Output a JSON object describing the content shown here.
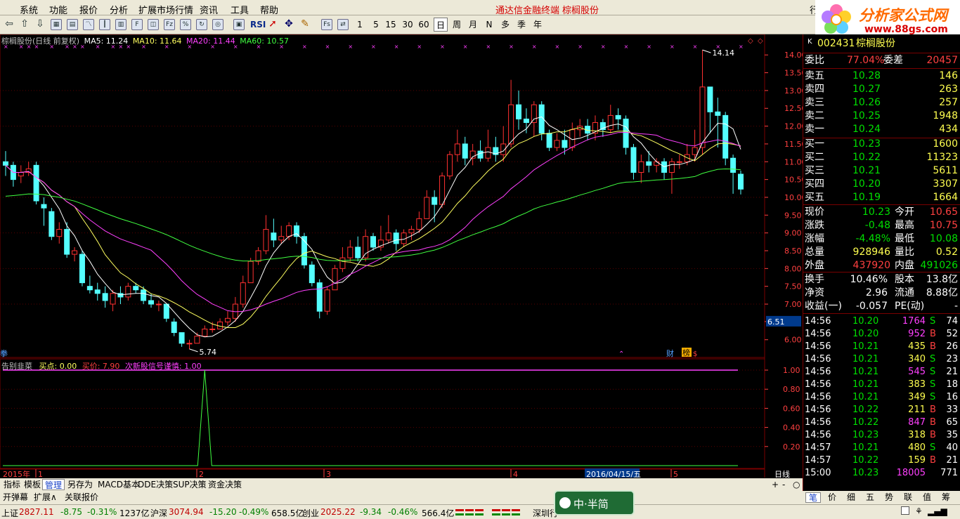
{
  "menu": {
    "items": [
      "系统",
      "功能",
      "报价",
      "分析",
      "扩展市场行情",
      "资讯",
      "工具",
      "帮助"
    ],
    "center_title": "通达信金融终端",
    "stock_title": "棕榈股份",
    "right_btn": "行"
  },
  "logo": {
    "text": "分析家公式网",
    "url": "www.88gs.com"
  },
  "toolbar": {
    "periods": [
      "1",
      "5",
      "15",
      "30",
      "60"
    ],
    "cycles": [
      "日",
      "周",
      "月",
      "N",
      "多",
      "季",
      "年"
    ],
    "selected_cycle": "日",
    "rsi": "RSI"
  },
  "chart_header": {
    "title": "棕榈股份(日线 前复权)",
    "ma5": "MA5: 11.24",
    "ma10": "MA10: 11.64",
    "ma20": "MA20: 11.44",
    "ma60": "MA60: 10.57"
  },
  "indicator_header": {
    "name": "告别韭菜",
    "buy_point": "买点: 0.00",
    "buy_price": "买价: 7.90",
    "signal": "次新股信号谨慎: 1.00"
  },
  "price_axis": [
    "14.00",
    "13.50",
    "13.00",
    "12.50",
    "12.00",
    "11.50",
    "11.00",
    "10.50",
    "10.00",
    "9.50",
    "9.00",
    "8.50",
    "8.00",
    "7.50",
    "7.00",
    "6.51",
    "6.00"
  ],
  "crosshair_price": "6.51",
  "indicator_axis": [
    "1.00",
    "0.80",
    "0.60",
    "0.40",
    "0.20"
  ],
  "annotations": {
    "high": "14.14",
    "low": "5.74",
    "fin": "财",
    "rank": "榜",
    "quan": "$",
    "left_mark": "拳"
  },
  "time_axis": {
    "year": "2015年",
    "months": [
      "1",
      "2",
      "3",
      "4",
      "5"
    ],
    "cursor_date": "2016/04/15/五",
    "period": "日线"
  },
  "chart_data": {
    "type": "candlestick",
    "title": "棕榈股份(日线 前复权)",
    "ylim": [
      5.6,
      14.3
    ],
    "candles": [
      [
        11.0,
        10.9,
        11.3,
        10.6
      ],
      [
        10.9,
        10.5,
        11.0,
        10.3
      ],
      [
        10.6,
        10.7,
        10.9,
        10.4
      ],
      [
        10.7,
        10.8,
        11.0,
        10.6
      ],
      [
        10.9,
        9.9,
        11.0,
        9.8
      ],
      [
        9.8,
        9.7,
        10.0,
        9.2
      ],
      [
        9.6,
        8.9,
        9.7,
        8.8
      ],
      [
        8.9,
        9.1,
        9.3,
        8.7
      ],
      [
        9.1,
        8.4,
        9.3,
        8.3
      ],
      [
        8.4,
        8.5,
        8.6,
        8.2
      ],
      [
        8.4,
        7.6,
        8.5,
        7.5
      ],
      [
        7.5,
        7.4,
        7.8,
        7.3
      ],
      [
        7.4,
        7.3,
        7.6,
        7.1
      ],
      [
        7.3,
        7.1,
        7.5,
        6.9
      ],
      [
        7.0,
        7.3,
        7.4,
        6.8
      ],
      [
        7.3,
        7.2,
        7.5,
        7.0
      ],
      [
        7.2,
        7.5,
        7.6,
        7.1
      ],
      [
        7.5,
        7.4,
        7.6,
        7.3
      ],
      [
        7.4,
        7.1,
        7.5,
        7.0
      ],
      [
        7.1,
        7.0,
        7.3,
        6.9
      ],
      [
        7.0,
        7.0,
        7.1,
        6.8
      ],
      [
        7.0,
        6.6,
        7.0,
        6.5
      ],
      [
        6.5,
        6.2,
        6.6,
        6.1
      ],
      [
        6.2,
        5.9,
        6.2,
        5.8
      ],
      [
        5.9,
        5.9,
        6.0,
        5.74
      ],
      [
        5.9,
        6.1,
        6.2,
        5.9
      ],
      [
        6.1,
        6.3,
        6.4,
        6.1
      ],
      [
        6.3,
        6.3,
        6.5,
        6.2
      ],
      [
        6.3,
        6.5,
        6.6,
        6.3
      ],
      [
        6.5,
        6.6,
        6.8,
        6.4
      ],
      [
        6.6,
        7.0,
        7.2,
        6.5
      ],
      [
        7.0,
        7.6,
        7.8,
        6.9
      ],
      [
        7.6,
        8.2,
        8.3,
        7.6
      ],
      [
        8.2,
        8.5,
        8.6,
        8.1
      ],
      [
        8.5,
        9.1,
        9.5,
        8.4
      ],
      [
        9.0,
        8.8,
        9.4,
        8.6
      ],
      [
        8.8,
        8.9,
        9.2,
        8.7
      ],
      [
        8.9,
        9.2,
        9.3,
        8.8
      ],
      [
        9.2,
        8.9,
        9.3,
        8.7
      ],
      [
        8.9,
        8.1,
        9.0,
        8.0
      ],
      [
        8.1,
        7.6,
        8.2,
        7.5
      ],
      [
        7.6,
        6.8,
        7.7,
        6.6
      ],
      [
        6.8,
        7.4,
        7.5,
        6.7
      ],
      [
        7.4,
        8.0,
        8.1,
        7.4
      ],
      [
        8.0,
        8.3,
        8.6,
        7.9
      ],
      [
        8.3,
        8.6,
        8.8,
        8.2
      ],
      [
        8.6,
        8.3,
        8.9,
        8.2
      ],
      [
        8.3,
        8.9,
        9.1,
        8.2
      ],
      [
        8.9,
        8.6,
        9.0,
        8.5
      ],
      [
        8.6,
        8.8,
        9.2,
        8.5
      ],
      [
        8.8,
        9.0,
        9.5,
        8.7
      ],
      [
        9.0,
        8.7,
        9.1,
        8.5
      ],
      [
        8.7,
        9.0,
        9.1,
        8.6
      ],
      [
        9.0,
        9.1,
        9.2,
        8.8
      ],
      [
        9.1,
        9.4,
        9.6,
        9.0
      ],
      [
        9.4,
        10.0,
        10.2,
        9.4
      ],
      [
        10.0,
        9.8,
        10.2,
        9.3
      ],
      [
        9.8,
        10.6,
        10.7,
        9.7
      ],
      [
        10.6,
        11.2,
        11.3,
        10.5
      ],
      [
        11.2,
        11.5,
        11.9,
        11.0
      ],
      [
        11.5,
        11.1,
        11.7,
        10.9
      ],
      [
        11.1,
        11.3,
        11.5,
        10.9
      ],
      [
        11.3,
        11.1,
        11.6,
        11.0
      ],
      [
        11.1,
        11.4,
        11.9,
        11.0
      ],
      [
        11.4,
        11.2,
        11.7,
        11.0
      ],
      [
        11.2,
        11.5,
        12.0,
        11.0
      ],
      [
        11.5,
        12.6,
        13.3,
        11.4
      ],
      [
        12.6,
        12.2,
        13.0,
        11.9
      ],
      [
        12.2,
        12.1,
        12.5,
        11.8
      ],
      [
        12.1,
        12.6,
        12.7,
        11.7
      ],
      [
        12.6,
        11.8,
        12.7,
        11.6
      ],
      [
        11.8,
        11.4,
        11.9,
        11.3
      ],
      [
        11.4,
        11.6,
        11.8,
        11.3
      ],
      [
        11.6,
        11.4,
        11.9,
        11.2
      ],
      [
        11.4,
        11.9,
        12.1,
        11.3
      ],
      [
        11.9,
        12.0,
        12.2,
        11.7
      ],
      [
        12.0,
        11.8,
        12.2,
        11.6
      ],
      [
        11.8,
        12.1,
        12.3,
        11.6
      ],
      [
        12.1,
        11.9,
        12.2,
        11.7
      ],
      [
        11.9,
        12.3,
        12.6,
        11.8
      ],
      [
        12.3,
        12.2,
        12.5,
        11.9
      ],
      [
        12.2,
        11.4,
        12.3,
        11.2
      ],
      [
        11.4,
        10.7,
        11.5,
        10.5
      ],
      [
        10.7,
        11.0,
        11.2,
        10.4
      ],
      [
        11.0,
        10.9,
        11.3,
        10.7
      ],
      [
        10.9,
        11.0,
        11.1,
        10.7
      ],
      [
        11.0,
        10.7,
        11.1,
        10.5
      ],
      [
        10.7,
        11.0,
        11.1,
        10.1
      ],
      [
        11.0,
        11.0,
        11.2,
        10.8
      ],
      [
        11.0,
        11.2,
        11.5,
        10.9
      ],
      [
        11.2,
        11.4,
        11.9,
        11.0
      ],
      [
        11.4,
        13.1,
        14.14,
        11.2
      ],
      [
        13.1,
        12.4,
        13.0,
        11.8
      ],
      [
        12.4,
        12.3,
        12.8,
        11.4
      ],
      [
        12.3,
        11.1,
        12.4,
        10.9
      ],
      [
        11.1,
        10.7,
        11.2,
        10.1
      ],
      [
        10.65,
        10.23,
        10.75,
        10.08
      ]
    ],
    "indicator_signal_index": 26
  },
  "quote": {
    "code": "002431",
    "name": "棕榈股份",
    "wb_label": "委比",
    "wb": "77.04%",
    "wc_label": "委差",
    "wc": "20457",
    "asks": [
      {
        "label": "卖五",
        "price": "10.28",
        "vol": "146"
      },
      {
        "label": "卖四",
        "price": "10.27",
        "vol": "263"
      },
      {
        "label": "卖三",
        "price": "10.26",
        "vol": "257"
      },
      {
        "label": "卖二",
        "price": "10.25",
        "vol": "1948"
      },
      {
        "label": "卖一",
        "price": "10.24",
        "vol": "434"
      }
    ],
    "bids": [
      {
        "label": "买一",
        "price": "10.23",
        "vol": "1600"
      },
      {
        "label": "买二",
        "price": "10.22",
        "vol": "11323"
      },
      {
        "label": "买三",
        "price": "10.21",
        "vol": "5611"
      },
      {
        "label": "买四",
        "price": "10.20",
        "vol": "3307"
      },
      {
        "label": "买五",
        "price": "10.19",
        "vol": "1664"
      }
    ],
    "stats": [
      {
        "l1": "现价",
        "v1": "10.23",
        "l2": "今开",
        "v2": "10.65",
        "c1": "grn",
        "c2": "red"
      },
      {
        "l1": "涨跌",
        "v1": "-0.48",
        "l2": "最高",
        "v2": "10.75",
        "c1": "grn",
        "c2": "red"
      },
      {
        "l1": "涨幅",
        "v1": "-4.48%",
        "l2": "最低",
        "v2": "10.08",
        "c1": "grn",
        "c2": "grn"
      },
      {
        "l1": "总量",
        "v1": "928946",
        "l2": "量比",
        "v2": "0.52",
        "c1": "yel",
        "c2": "yel"
      },
      {
        "l1": "外盘",
        "v1": "437920",
        "l2": "内盘",
        "v2": "491026",
        "c1": "red",
        "c2": "grn"
      },
      {
        "l1": "换手",
        "v1": "10.46%",
        "l2": "股本",
        "v2": "13.8亿",
        "c1": "wht",
        "c2": "wht"
      },
      {
        "l1": "净资",
        "v1": "2.96",
        "l2": "流通",
        "v2": "8.88亿",
        "c1": "wht",
        "c2": "wht"
      },
      {
        "l1": "收益(一)",
        "v1": "-0.057",
        "l2": "PE(动)",
        "v2": "-",
        "c1": "wht",
        "c2": "wht"
      }
    ],
    "ticks": [
      {
        "t": "14:56",
        "p": "10.20",
        "v": "1764",
        "s": "S",
        "n": "74",
        "vc": "mag"
      },
      {
        "t": "14:56",
        "p": "10.20",
        "v": "952",
        "s": "B",
        "n": "52",
        "vc": "mag"
      },
      {
        "t": "14:56",
        "p": "10.21",
        "v": "435",
        "s": "B",
        "n": "26",
        "vc": "yel"
      },
      {
        "t": "14:56",
        "p": "10.21",
        "v": "340",
        "s": "S",
        "n": "23",
        "vc": "yel"
      },
      {
        "t": "14:56",
        "p": "10.21",
        "v": "545",
        "s": "S",
        "n": "21",
        "vc": "mag"
      },
      {
        "t": "14:56",
        "p": "10.21",
        "v": "383",
        "s": "S",
        "n": "18",
        "vc": "yel"
      },
      {
        "t": "14:56",
        "p": "10.21",
        "v": "349",
        "s": "S",
        "n": "16",
        "vc": "yel"
      },
      {
        "t": "14:56",
        "p": "10.22",
        "v": "211",
        "s": "B",
        "n": "33",
        "vc": "yel"
      },
      {
        "t": "14:56",
        "p": "10.22",
        "v": "847",
        "s": "B",
        "n": "65",
        "vc": "mag"
      },
      {
        "t": "14:56",
        "p": "10.23",
        "v": "318",
        "s": "B",
        "n": "35",
        "vc": "yel"
      },
      {
        "t": "14:57",
        "p": "10.21",
        "v": "480",
        "s": "S",
        "n": "40",
        "vc": "yel"
      },
      {
        "t": "14:57",
        "p": "10.22",
        "v": "159",
        "s": "B",
        "n": "21",
        "vc": "yel"
      },
      {
        "t": "15:00",
        "p": "10.23",
        "v": "18005",
        "s": "",
        "n": "771",
        "vc": "mag"
      }
    ],
    "right_tabs": [
      "笔",
      "价",
      "细",
      "五",
      "势",
      "联",
      "值",
      "筹"
    ]
  },
  "bottom_tabs": [
    "指标",
    "模板",
    "管理",
    "另存为",
    "MACD基本",
    "DDE决策",
    "SUP决策",
    "资金决策"
  ],
  "bottom_active": "管理",
  "bottom2": [
    "开弹幕",
    "扩展∧",
    "关联报价"
  ],
  "zoom": [
    "+",
    "-",
    "○"
  ],
  "status": {
    "sh_label": "上证",
    "sh": "2827.11",
    "sh_chg": "-8.75",
    "sh_pct": "-0.31%",
    "sh_amt": "1237亿",
    "sz_label": "沪深",
    "sz": "3074.94",
    "sz_chg": "-15.20",
    "sz_pct": "-0.49%",
    "sz_amt": "658.5亿",
    "cy_label": "创业",
    "cy": "2025.22",
    "cy_chg": "-9.34",
    "cy_pct": "-0.46%",
    "cy_amt": "566.4亿",
    "market": "深圳行",
    "badge": "中·半简"
  }
}
